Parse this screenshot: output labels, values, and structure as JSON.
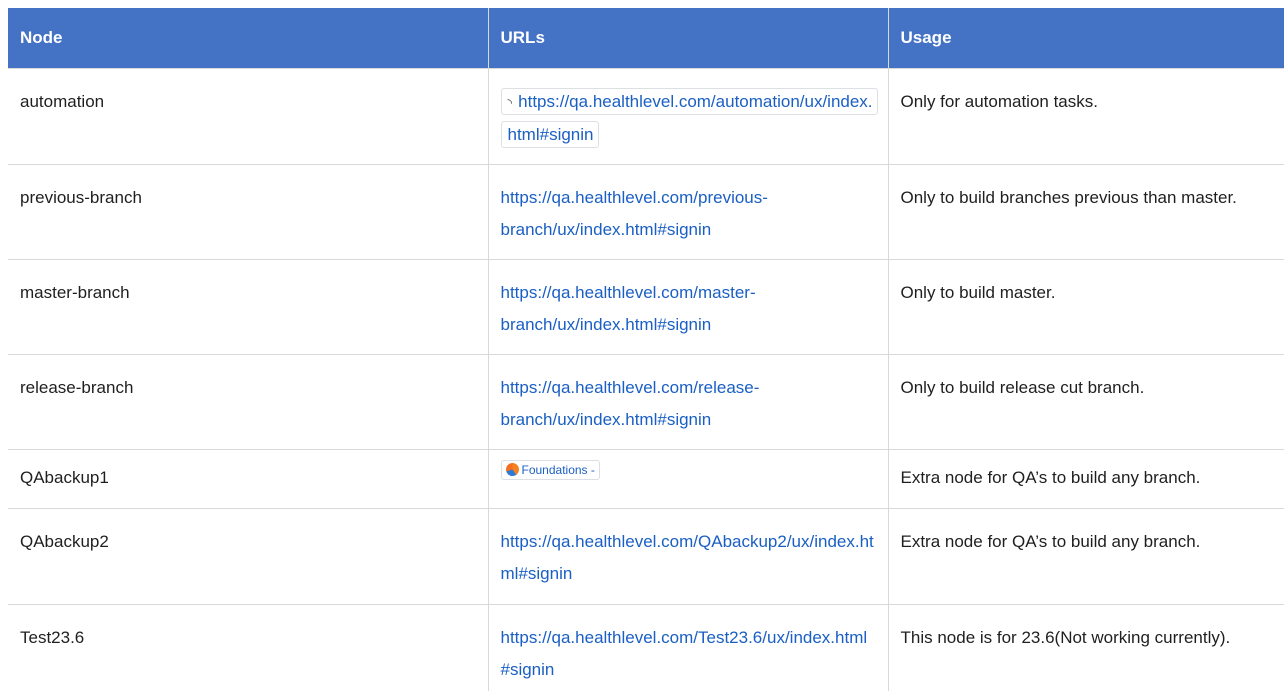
{
  "table": {
    "headers": [
      "Node",
      "URLs",
      "Usage"
    ],
    "rows": [
      {
        "node": "automation",
        "url": "https://qa.healthlevel.com/automation/ux/index.html#signin",
        "url_style": "smart-link",
        "url_icon": "link-icon",
        "usage": "Only for automation tasks."
      },
      {
        "node": "previous-branch",
        "url": "https://qa.healthlevel.com/previous-branch/ux/index.html#signin",
        "usage": "Only to build branches previous than master."
      },
      {
        "node": "master-branch",
        "url": "https://qa.healthlevel.com/master-branch/ux/index.html#signin",
        "usage": "Only to build master."
      },
      {
        "node": "release-branch",
        "url": "https://qa.healthlevel.com/release-branch/ux/index.html#signin",
        "usage": "Only to build release cut branch."
      },
      {
        "node": "QAbackup1",
        "url": "Foundations -",
        "url_style": "chip",
        "url_icon": "foundations-logo-icon",
        "usage": "Extra node for QA’s to build any branch."
      },
      {
        "node": "QAbackup2",
        "url": "https://qa.healthlevel.com/QAbackup2/ux/index.html#signin",
        "usage": "Extra node for QA’s to build any branch."
      },
      {
        "node": "Test23.6",
        "url": "https://qa.healthlevel.com/Test23.6/ux/index.html#signin",
        "usage": "This node is for 23.6(Not working currently)."
      }
    ]
  },
  "colors": {
    "header_bg": "#4472c4",
    "header_text": "#ffffff",
    "link": "#1a5fc4",
    "grid": "#d9d9d9"
  }
}
